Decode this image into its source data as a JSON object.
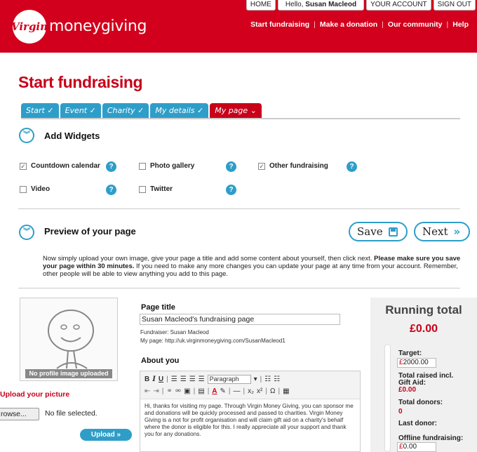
{
  "header": {
    "brand": "moneygiving",
    "logo_text": "Virgin",
    "top_tabs": {
      "home": "HOME",
      "hello": "Hello, ",
      "user": "Susan Macleod",
      "account": "YOUR ACCOUNT",
      "signout": "SIGN OUT"
    },
    "nav": [
      "Start fundraising",
      "Make a donation",
      "Our community",
      "Help"
    ]
  },
  "page_title": "Start fundraising",
  "steps": [
    "Start ✓",
    "Event ✓",
    "Charity ✓",
    "My details ✓",
    "My page ⌄"
  ],
  "widgets": {
    "title": "Add Widgets",
    "items": [
      {
        "label": "Countdown calendar",
        "checked": true
      },
      {
        "label": "Photo gallery",
        "checked": false
      },
      {
        "label": "Other fundraising",
        "checked": true
      },
      {
        "label": "Video",
        "checked": false
      },
      {
        "label": "Twitter",
        "checked": false
      }
    ]
  },
  "preview": {
    "title": "Preview of your page",
    "save": "Save",
    "next": "Next",
    "intro_1": "Now simply upload your own image, give your page a title and add some content about yourself, then click next. ",
    "intro_bold": "Please make sure you save your page within 30 minutes.",
    "intro_2": " If you need to make any more changes you can update your page at any time from your account. Remember, other people will be able to view anything you add to this page."
  },
  "picture": {
    "no_image": "No profile image uploaded",
    "upload_label": "Upload your picture",
    "file_button": "rowse...",
    "file_status": "No file selected.",
    "upload_button": "Upload"
  },
  "page_info": {
    "title_label": "Page title",
    "title_value": "Susan Macleod's fundraising page",
    "fundraiser": "Fundraiser: Susan Macleod",
    "my_page": "My page: http://uk.virginmoneygiving.com/SusanMacleod1",
    "about_label": "About you",
    "format_select": "Paragraph",
    "about_text": "Hi, thanks for visiting my page. Through Virgin Money Giving, you can sponsor me and donations will be quickly processed and passed to charities. Virgin Money Giving is a not for profit organisation and will claim gift aid on a charity's behalf where the donor is eligible for this. I really appreciate all your support and thank you for any donations."
  },
  "running_total": {
    "title": "Running total",
    "amount": "£0.00",
    "target_label": "Target:",
    "target_currency": "£",
    "target_value": "2000.00",
    "raised_label_1": "Total raised incl.",
    "raised_label_2": "Gift Aid:",
    "raised_value": "£0.00",
    "donors_label": "Total donors:",
    "donors_value": "0",
    "last_donor_label": "Last donor:",
    "offline_label": "Offline fundraising:",
    "offline_currency": "£",
    "offline_value": "0.00"
  },
  "colors": {
    "brand_red": "#d2001c",
    "accent_blue": "#2e9ec9"
  }
}
